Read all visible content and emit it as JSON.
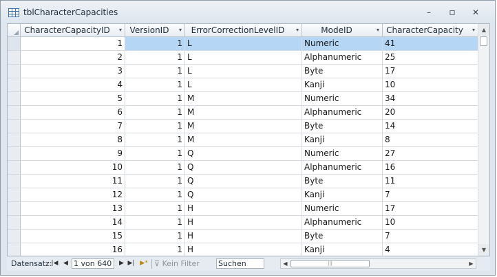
{
  "window": {
    "title": "tblCharacterCapacities",
    "minimize_glyph": "–",
    "restore_glyph": "▫",
    "close_glyph": "✕",
    "icon": "table-icon"
  },
  "columns": [
    {
      "key": "id",
      "label": "CharacterCapacityID"
    },
    {
      "key": "version",
      "label": "VersionID"
    },
    {
      "key": "ecl",
      "label": "ErrorCorrectionLevelID"
    },
    {
      "key": "mode",
      "label": "ModeID"
    },
    {
      "key": "cap",
      "label": "CharacterCapacity"
    }
  ],
  "dropdown_glyph": "▾",
  "rows": [
    {
      "id": "1",
      "version": "1",
      "ecl": "L",
      "mode": "Numeric",
      "cap": "41"
    },
    {
      "id": "2",
      "version": "1",
      "ecl": "L",
      "mode": "Alphanumeric",
      "cap": "25"
    },
    {
      "id": "3",
      "version": "1",
      "ecl": "L",
      "mode": "Byte",
      "cap": "17"
    },
    {
      "id": "4",
      "version": "1",
      "ecl": "L",
      "mode": "Kanji",
      "cap": "10"
    },
    {
      "id": "5",
      "version": "1",
      "ecl": "M",
      "mode": "Numeric",
      "cap": "34"
    },
    {
      "id": "6",
      "version": "1",
      "ecl": "M",
      "mode": "Alphanumeric",
      "cap": "20"
    },
    {
      "id": "7",
      "version": "1",
      "ecl": "M",
      "mode": "Byte",
      "cap": "14"
    },
    {
      "id": "8",
      "version": "1",
      "ecl": "M",
      "mode": "Kanji",
      "cap": "8"
    },
    {
      "id": "9",
      "version": "1",
      "ecl": "Q",
      "mode": "Numeric",
      "cap": "27"
    },
    {
      "id": "10",
      "version": "1",
      "ecl": "Q",
      "mode": "Alphanumeric",
      "cap": "16"
    },
    {
      "id": "11",
      "version": "1",
      "ecl": "Q",
      "mode": "Byte",
      "cap": "11"
    },
    {
      "id": "12",
      "version": "1",
      "ecl": "Q",
      "mode": "Kanji",
      "cap": "7"
    },
    {
      "id": "13",
      "version": "1",
      "ecl": "H",
      "mode": "Numeric",
      "cap": "17"
    },
    {
      "id": "14",
      "version": "1",
      "ecl": "H",
      "mode": "Alphanumeric",
      "cap": "10"
    },
    {
      "id": "15",
      "version": "1",
      "ecl": "H",
      "mode": "Byte",
      "cap": "7"
    },
    {
      "id": "16",
      "version": "1",
      "ecl": "H",
      "mode": "Kanji",
      "cap": "4"
    }
  ],
  "current_row": 0,
  "nav": {
    "label": "Datensatz:",
    "first": "|◀",
    "prev": "◀",
    "record": "1 von 640",
    "next": "▶",
    "last": "▶|",
    "new": "▶*",
    "filter_icon": "funnel-icon",
    "filter_label": "Kein Filter",
    "search": "Suchen"
  },
  "scroll": {
    "up": "▲",
    "down": "▼",
    "left": "◀",
    "right": "▶",
    "grip": "|||"
  },
  "colors": {
    "selection": "#b5d6f5",
    "frame": "#dfe6ee"
  }
}
